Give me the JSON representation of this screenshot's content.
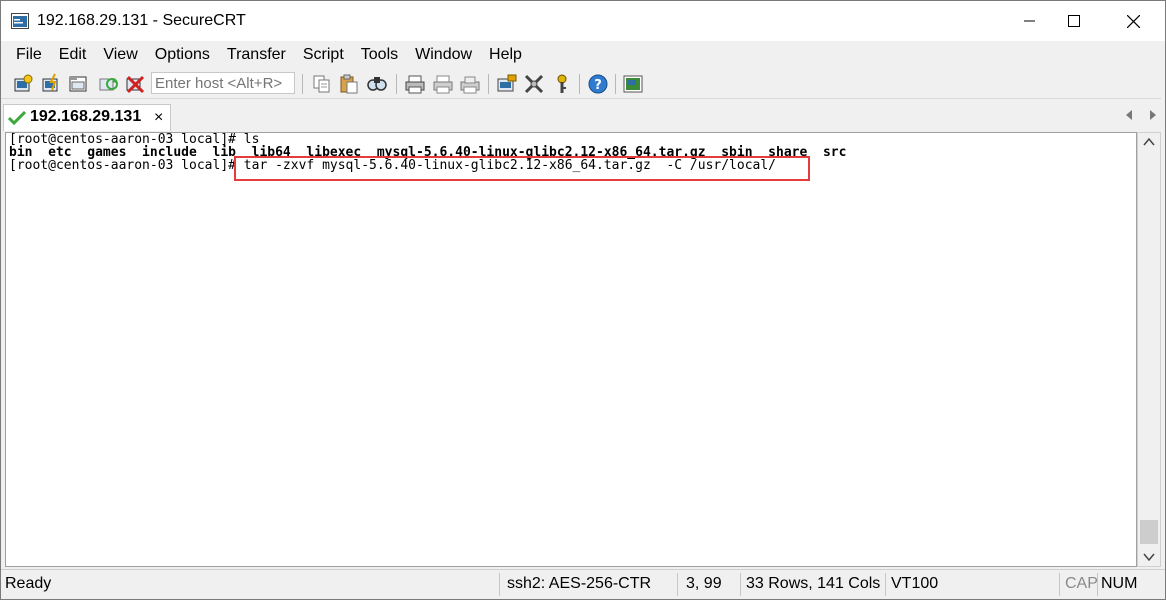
{
  "window": {
    "title": "192.168.29.131 - SecureCRT"
  },
  "menu": [
    "File",
    "Edit",
    "View",
    "Options",
    "Transfer",
    "Script",
    "Tools",
    "Window",
    "Help"
  ],
  "toolbar": {
    "host_placeholder": "Enter host <Alt+R>",
    "icons": [
      "connect-icon",
      "quick-connect-icon",
      "connect-in-tab-icon",
      "reconnect-icon",
      "disconnect-icon",
      "copy-icon",
      "paste-icon",
      "find-icon",
      "print-icon",
      "print-selection-icon",
      "print-screen-icon",
      "session-options-icon",
      "global-options-icon",
      "keymap-icon",
      "help-icon",
      "about-icon"
    ]
  },
  "tab": {
    "label": "192.168.29.131",
    "close": "×"
  },
  "terminal": {
    "lines": [
      "[root@centos-aaron-03 local]# ls",
      "",
      "[root@centos-aaron-03 local]# tar -zxvf mysql-5.6.40-linux-glibc2.12-x86_64.tar.gz  -C /usr/local/"
    ],
    "bold_line": "bin  etc  games  include  lib  lib64  libexec  mysql-5.6.40-linux-glibc2.12-x86_64.tar.gz  sbin  share  src"
  },
  "status": {
    "ready": "Ready",
    "cipher": "ssh2: AES-256-CTR",
    "cursor": "3,  99",
    "size": "33 Rows, 141 Cols",
    "term_type": "VT100",
    "cap": "CAP",
    "num": "NUM"
  },
  "colors": {
    "highlight_box": "#e43c3c",
    "tab_check": "#3aa83a"
  }
}
